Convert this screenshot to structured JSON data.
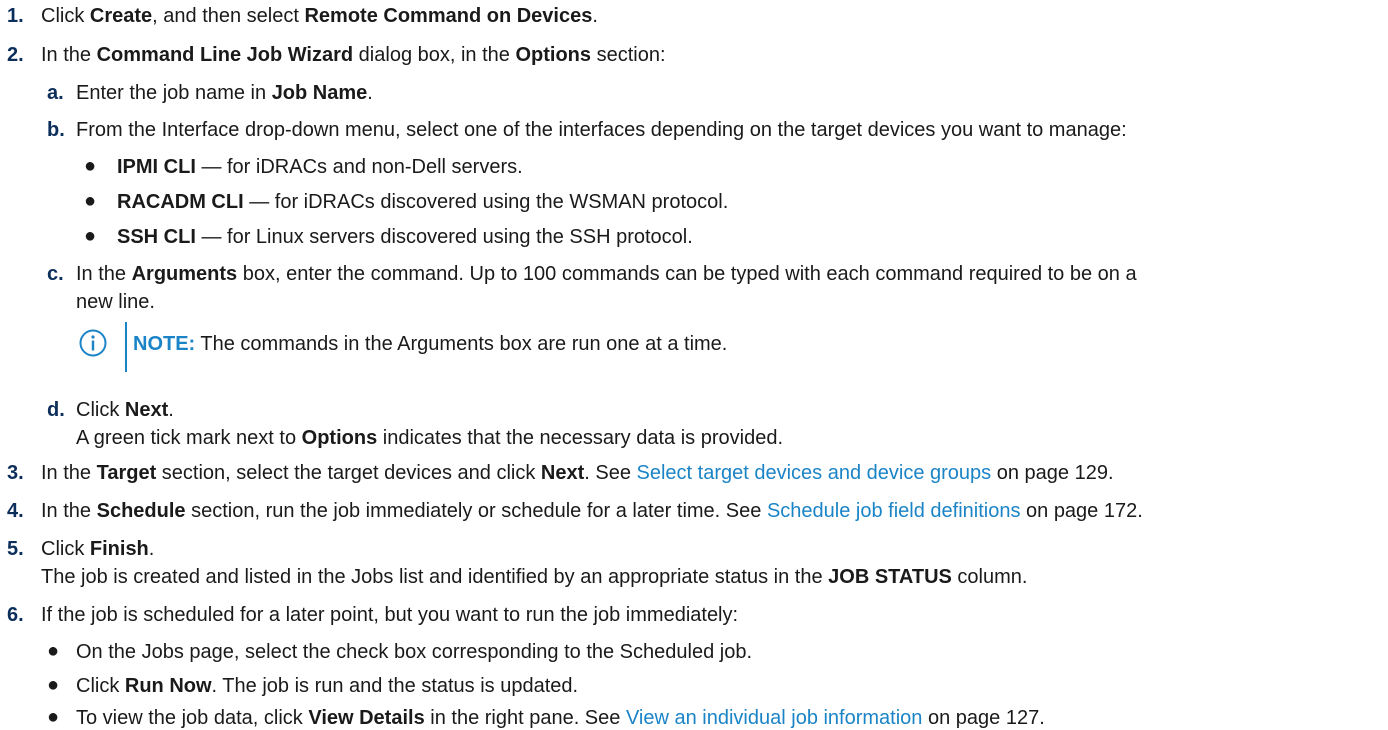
{
  "steps": {
    "s1": {
      "num": "1.",
      "pre": "Click ",
      "b1": "Create",
      "mid": ", and then select ",
      "b2": "Remote Command on Devices",
      "post": "."
    },
    "s2": {
      "num": "2.",
      "pre": "In the ",
      "b1": "Command Line Job Wizard",
      "mid": " dialog box, in the ",
      "b2": "Options",
      "post": " section:"
    },
    "s2a": {
      "num": "a.",
      "pre": "Enter the job name in ",
      "b1": "Job Name",
      "post": "."
    },
    "s2b": {
      "num": "b.",
      "text": "From the Interface drop-down menu, select one of the interfaces depending on the target devices you want to manage:"
    },
    "bullets_b": [
      {
        "bold": "IPMI CLI",
        "text": " — for iDRACs and non-Dell servers."
      },
      {
        "bold": "RACADM CLI",
        "text": " — for iDRACs discovered using the WSMAN protocol."
      },
      {
        "bold": "SSH CLI",
        "text": " — for Linux servers discovered using the SSH protocol."
      }
    ],
    "s2c": {
      "num": "c.",
      "pre": "In the ",
      "b1": "Arguments",
      "post": " box, enter the command. Up to 100 commands can be typed with each command required to be on a",
      "cont": "new line."
    },
    "note": {
      "label": "NOTE:",
      "text": " The commands in the Arguments box are run one at a time."
    },
    "s2d": {
      "num": "d.",
      "pre": "Click ",
      "b1": "Next",
      "post": ".",
      "cont_pre": "A green tick mark next to ",
      "cont_b": "Options",
      "cont_post": " indicates that the necessary data is provided."
    },
    "s3": {
      "num": "3.",
      "pre": "In the ",
      "b1": "Target",
      "mid": " section, select the target devices and click ",
      "b2": "Next",
      "mid2": ". See ",
      "link": "Select target devices and device groups",
      "post": " on page 129."
    },
    "s4": {
      "num": "4.",
      "pre": "In the ",
      "b1": "Schedule",
      "mid": " section, run the job immediately or schedule for a later time. See ",
      "link": "Schedule job field definitions",
      "post": " on page 172."
    },
    "s5": {
      "num": "5.",
      "pre": "Click ",
      "b1": "Finish",
      "post": ".",
      "cont_pre": "The job is created and listed in the Jobs list and identified by an appropriate status in the ",
      "cont_b": "JOB STATUS",
      "cont_post": " column."
    },
    "s6": {
      "num": "6.",
      "text": "If the job is scheduled for a later point, but you want to run the job immediately:"
    },
    "bullets_6": [
      {
        "pre": "On the Jobs page, select the check box corresponding to the Scheduled job."
      },
      {
        "pre": "Click ",
        "bold": "Run Now",
        "post": ". The job is run and the status is updated."
      },
      {
        "pre": "To view the job data, click ",
        "bold": "View Details",
        "post": " in the right pane. See ",
        "link": "View an individual job information",
        "tail": " on page 127."
      }
    ]
  },
  "colors": {
    "link": "#1b84c7",
    "numbering": "#0c2e5a",
    "text": "#1a1a1a"
  },
  "icons": {
    "note": "info-circle-icon",
    "bullet": "bullet-dot"
  }
}
